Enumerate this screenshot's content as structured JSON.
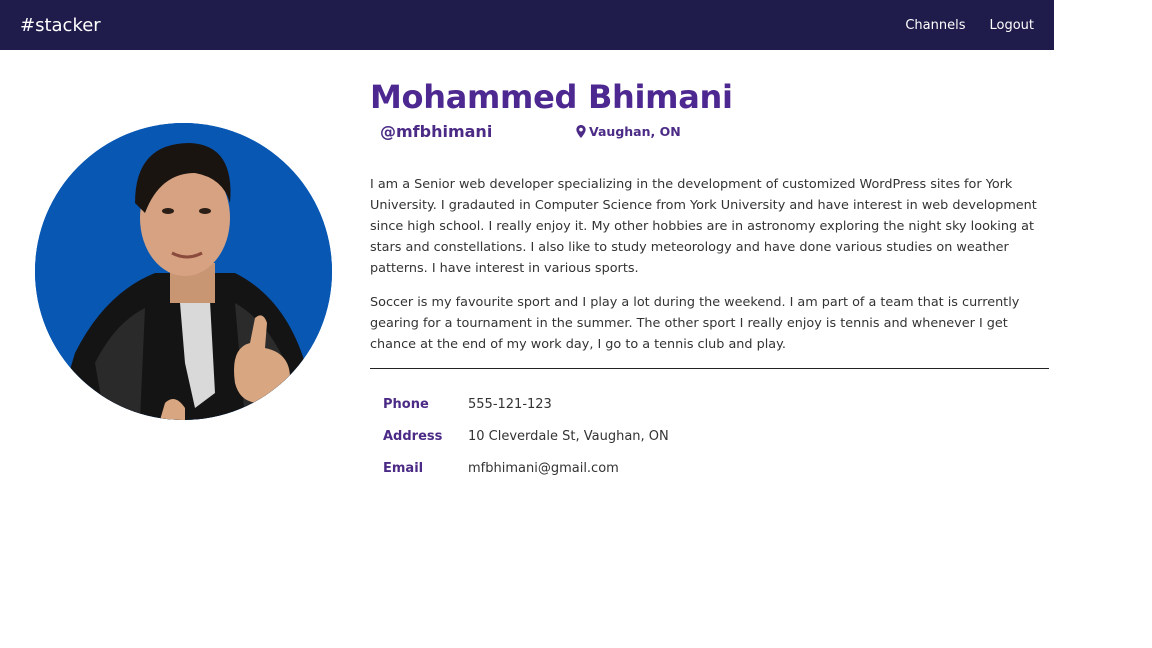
{
  "nav": {
    "brand": "#stacker",
    "links": [
      "Channels",
      "Logout"
    ]
  },
  "profile": {
    "name": "Mohammed Bhimani",
    "handle": "@mfbhimani",
    "location": "Vaughan, ON",
    "location_icon": "map-marker-icon",
    "bio": [
      "I am a Senior web developer specializing in the development of customized WordPress sites for York University. I gradauted in Computer Science from York University and have interest in web development since high school. I really enjoy it. My other hobbies are in astronomy exploring the night sky looking at stars and constellations. I also like to study meteorology and have done various studies on weather patterns. I have interest in various sports.",
      "Soccer is my favourite sport and I play a lot during the weekend. I am part of a team that is currently gearing for a tournament in the summer. The other sport I really enjoy is tennis and whenever I get chance at the end of my work day, I go to a tennis club and play."
    ],
    "contact": [
      {
        "label": "Phone",
        "value": "555-121-123"
      },
      {
        "label": "Address",
        "value": "10 Cleverdale St, Vaughan, ON"
      },
      {
        "label": "Email",
        "value": "mfbhimani@gmail.com"
      }
    ]
  },
  "colors": {
    "navbar": "#1f1c4b",
    "accent": "#4d2891",
    "avatar_bg": "#0757b3"
  }
}
